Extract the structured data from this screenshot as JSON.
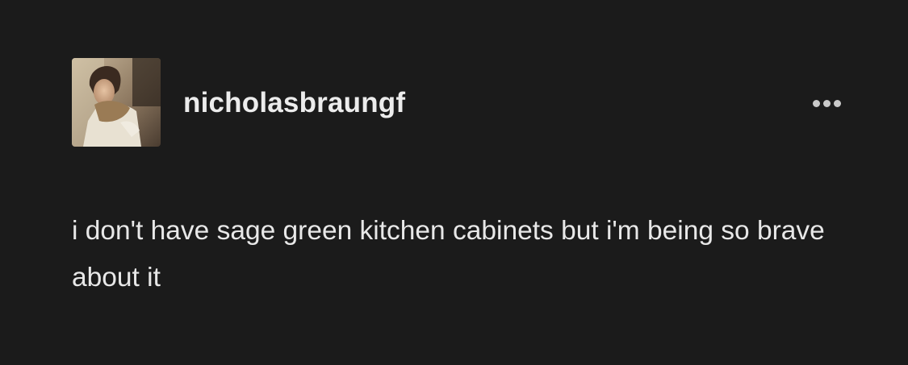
{
  "post": {
    "author": {
      "username": "nicholasbraungf"
    },
    "more_menu_icon": "ellipsis-icon",
    "body_text": "i don't have sage green kitchen cabinets but i'm being so brave about it"
  },
  "colors": {
    "background": "#1b1b1b",
    "text": "#e8e8e8",
    "icon": "#c9c9c9"
  }
}
